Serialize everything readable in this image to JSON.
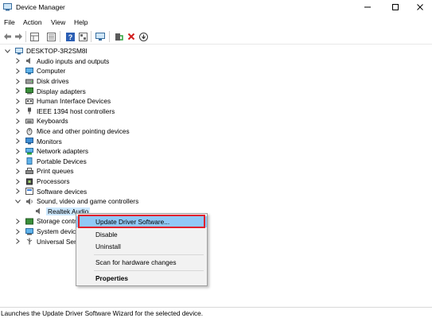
{
  "window": {
    "title": "Device Manager"
  },
  "menu": [
    "File",
    "Action",
    "View",
    "Help"
  ],
  "toolbar": {
    "icons": [
      "back-icon",
      "forward-icon",
      "properties-grid-icon",
      "view-list-icon",
      "help-icon",
      "view-icon",
      "monitor-icon",
      "update-driver-icon",
      "uninstall-icon",
      "scan-icon"
    ]
  },
  "tree": {
    "root": "DESKTOP-3R2SM8I",
    "items": [
      {
        "label": "Audio inputs and outputs",
        "icon": "speaker-icon"
      },
      {
        "label": "Computer",
        "icon": "computer-icon"
      },
      {
        "label": "Disk drives",
        "icon": "disk-icon"
      },
      {
        "label": "Display adapters",
        "icon": "display-adapter-icon"
      },
      {
        "label": "Human Interface Devices",
        "icon": "hid-icon"
      },
      {
        "label": "IEEE 1394 host controllers",
        "icon": "ieee-icon"
      },
      {
        "label": "Keyboards",
        "icon": "keyboard-icon"
      },
      {
        "label": "Mice and other pointing devices",
        "icon": "mouse-icon"
      },
      {
        "label": "Monitors",
        "icon": "monitor-icon"
      },
      {
        "label": "Network adapters",
        "icon": "network-icon"
      },
      {
        "label": "Portable Devices",
        "icon": "portable-device-icon"
      },
      {
        "label": "Print queues",
        "icon": "printer-icon"
      },
      {
        "label": "Processors",
        "icon": "processor-icon"
      },
      {
        "label": "Software devices",
        "icon": "software-device-icon"
      },
      {
        "label": "Sound, video and game controllers",
        "icon": "sound-icon"
      },
      {
        "label": "Realtek Audio",
        "icon": "speaker-icon"
      },
      {
        "label": "Storage contro",
        "icon": "storage-icon"
      },
      {
        "label": "System device",
        "icon": "system-device-icon"
      },
      {
        "label": "Universal Seria",
        "icon": "usb-icon"
      }
    ]
  },
  "context_menu": {
    "items": [
      "Update Driver Software...",
      "Disable",
      "Uninstall",
      "Scan for hardware changes",
      "Properties"
    ]
  },
  "status": "Launches the Update Driver Software Wizard for the selected device.",
  "colors": {
    "highlight": "#91c9f7",
    "selection": "#cce8ff",
    "red_box": "#e0212e"
  }
}
